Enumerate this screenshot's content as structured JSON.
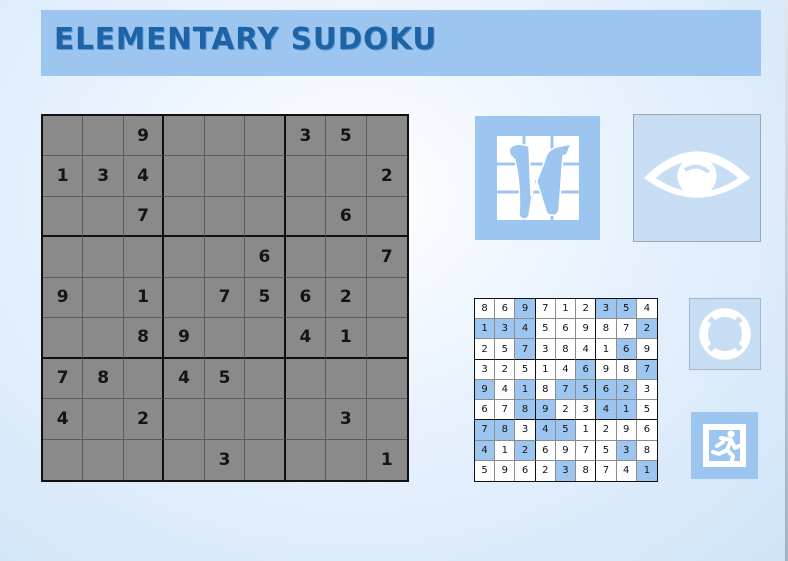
{
  "app": {
    "title": "ELEMENTARY SUDOKU"
  },
  "colors": {
    "banner": "#9cc6f0",
    "title_text": "#1d63a6",
    "cell_background": "#8a8a8a",
    "mini_highlight": "#9cc6f0",
    "button_fill": "#9cc6f0",
    "button_fill_light": "#c6ddf4"
  },
  "puzzle": {
    "rows": [
      [
        "",
        "",
        "9",
        "",
        "",
        "",
        "3",
        "5",
        ""
      ],
      [
        "1",
        "3",
        "4",
        "",
        "",
        "",
        "",
        "",
        "2"
      ],
      [
        "",
        "",
        "7",
        "",
        "",
        "",
        "",
        "6",
        ""
      ],
      [
        "",
        "",
        "",
        "",
        "",
        "6",
        "",
        "",
        "7"
      ],
      [
        "9",
        "",
        "1",
        "",
        "7",
        "5",
        "6",
        "2",
        ""
      ],
      [
        "",
        "",
        "8",
        "9",
        "",
        "",
        "4",
        "1",
        ""
      ],
      [
        "7",
        "8",
        "",
        "4",
        "5",
        "",
        "",
        "",
        ""
      ],
      [
        "4",
        "",
        "2",
        "",
        "",
        "",
        "",
        "3",
        ""
      ],
      [
        "",
        "",
        "",
        "",
        "3",
        "",
        "",
        "",
        "1"
      ]
    ]
  },
  "solution": {
    "rows": [
      [
        "8",
        "6",
        "9",
        "7",
        "1",
        "2",
        "3",
        "5",
        "4"
      ],
      [
        "1",
        "3",
        "4",
        "5",
        "6",
        "9",
        "8",
        "7",
        "2"
      ],
      [
        "2",
        "5",
        "7",
        "3",
        "8",
        "4",
        "1",
        "6",
        "9"
      ],
      [
        "3",
        "2",
        "5",
        "1",
        "4",
        "6",
        "9",
        "8",
        "7"
      ],
      [
        "9",
        "4",
        "1",
        "8",
        "7",
        "5",
        "6",
        "2",
        "3"
      ],
      [
        "6",
        "7",
        "8",
        "9",
        "2",
        "3",
        "4",
        "1",
        "5"
      ],
      [
        "7",
        "8",
        "3",
        "4",
        "5",
        "1",
        "2",
        "9",
        "6"
      ],
      [
        "4",
        "1",
        "2",
        "6",
        "9",
        "7",
        "5",
        "3",
        "8"
      ],
      [
        "5",
        "9",
        "6",
        "2",
        "3",
        "8",
        "7",
        "4",
        "1"
      ]
    ],
    "highlighted": [
      [
        0,
        2
      ],
      [
        0,
        6
      ],
      [
        0,
        7
      ],
      [
        1,
        0
      ],
      [
        1,
        1
      ],
      [
        1,
        2
      ],
      [
        1,
        8
      ],
      [
        2,
        2
      ],
      [
        2,
        7
      ],
      [
        3,
        5
      ],
      [
        3,
        8
      ],
      [
        4,
        0
      ],
      [
        4,
        2
      ],
      [
        4,
        4
      ],
      [
        4,
        5
      ],
      [
        4,
        6
      ],
      [
        4,
        7
      ],
      [
        5,
        2
      ],
      [
        5,
        3
      ],
      [
        5,
        6
      ],
      [
        5,
        7
      ],
      [
        6,
        0
      ],
      [
        6,
        1
      ],
      [
        6,
        3
      ],
      [
        6,
        4
      ],
      [
        7,
        0
      ],
      [
        7,
        2
      ],
      [
        7,
        7
      ],
      [
        8,
        4
      ],
      [
        8,
        8
      ]
    ]
  },
  "buttons": {
    "new_game": {
      "icon": "new-game-n-icon"
    },
    "reveal": {
      "icon": "eye-icon"
    },
    "hint": {
      "icon": "lifebuoy-icon"
    },
    "exit": {
      "icon": "exit-running-man-icon"
    }
  }
}
